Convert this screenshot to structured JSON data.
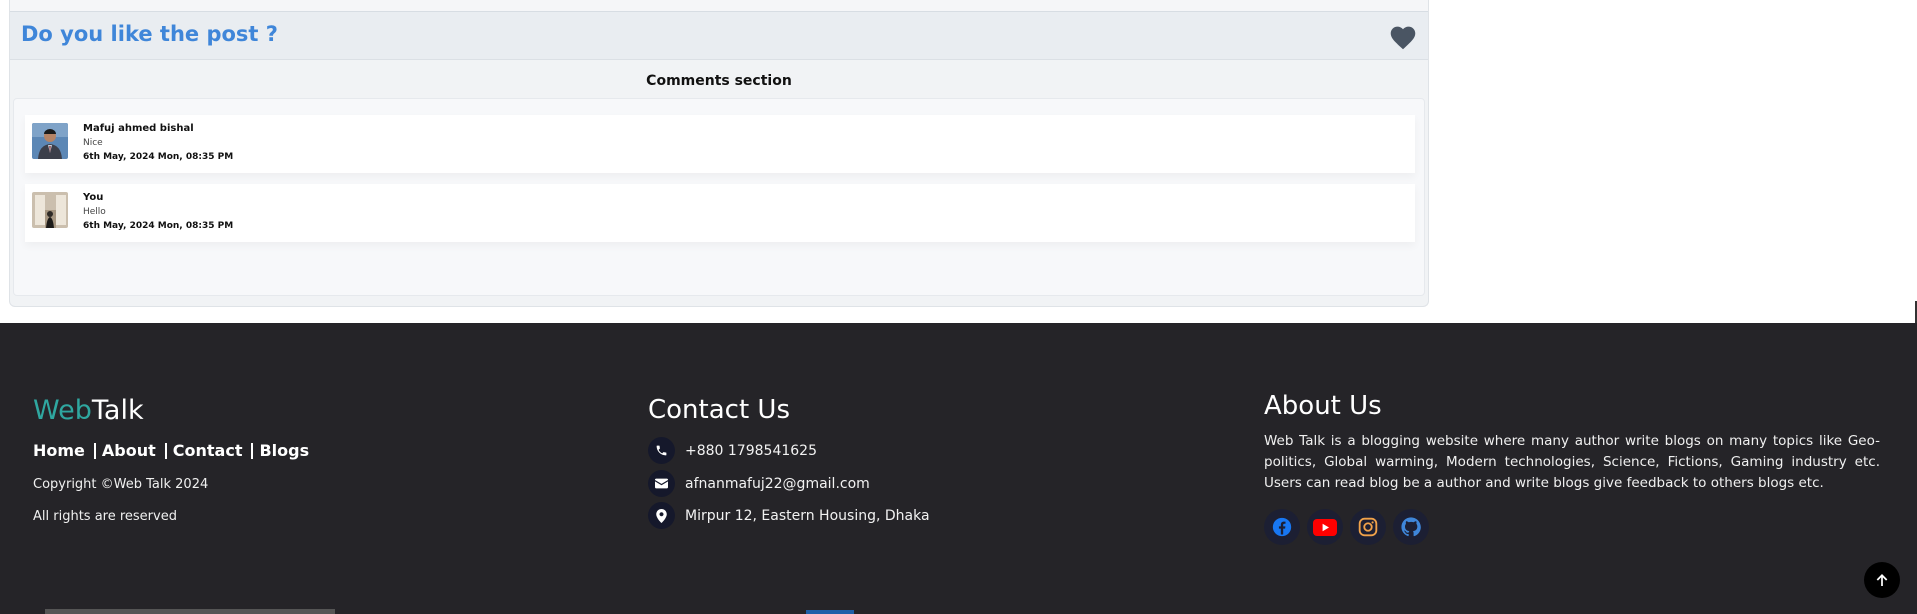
{
  "post": {
    "like_prompt": "Do you like the post ?",
    "comments_title": "Comments section",
    "comments": [
      {
        "author": "Mafuj ahmed bishal",
        "text": "Nice",
        "time": "6th May, 2024 Mon, 08:35 PM",
        "avatar": "avatar-photo-man"
      },
      {
        "author": "You",
        "text": "Hello",
        "time": "6th May, 2024 Mon, 08:35 PM",
        "avatar": "avatar-photo-room"
      }
    ],
    "accent_color": "#3f86d9"
  },
  "footer": {
    "brand_web": "Web",
    "brand_talk": "Talk",
    "nav": [
      "Home",
      "About",
      "Contact",
      "Blogs"
    ],
    "copyright": "Copyright ©Web Talk 2024",
    "rights": "All rights are reserved",
    "contact_title": "Contact Us",
    "contacts": [
      {
        "icon": "phone-icon",
        "text": "+880 1798541625"
      },
      {
        "icon": "envelope-icon",
        "text": "afnanmafuj22@gmail.com"
      },
      {
        "icon": "location-pin-icon",
        "text": "Mirpur 12, Eastern Housing, Dhaka"
      }
    ],
    "about_title": "About Us",
    "about_text": "Web Talk is a blogging website where many author write blogs on many topics like Geo-politics, Global warming, Modern technologies, Science, Fictions, Gaming industry etc. Users can read blog be a author and write blogs give feedback to others blogs etc.",
    "socials": [
      "facebook-icon",
      "youtube-icon",
      "instagram-icon",
      "github-icon"
    ],
    "background_color": "#252428",
    "brand_accent": "#2fa7a0"
  }
}
